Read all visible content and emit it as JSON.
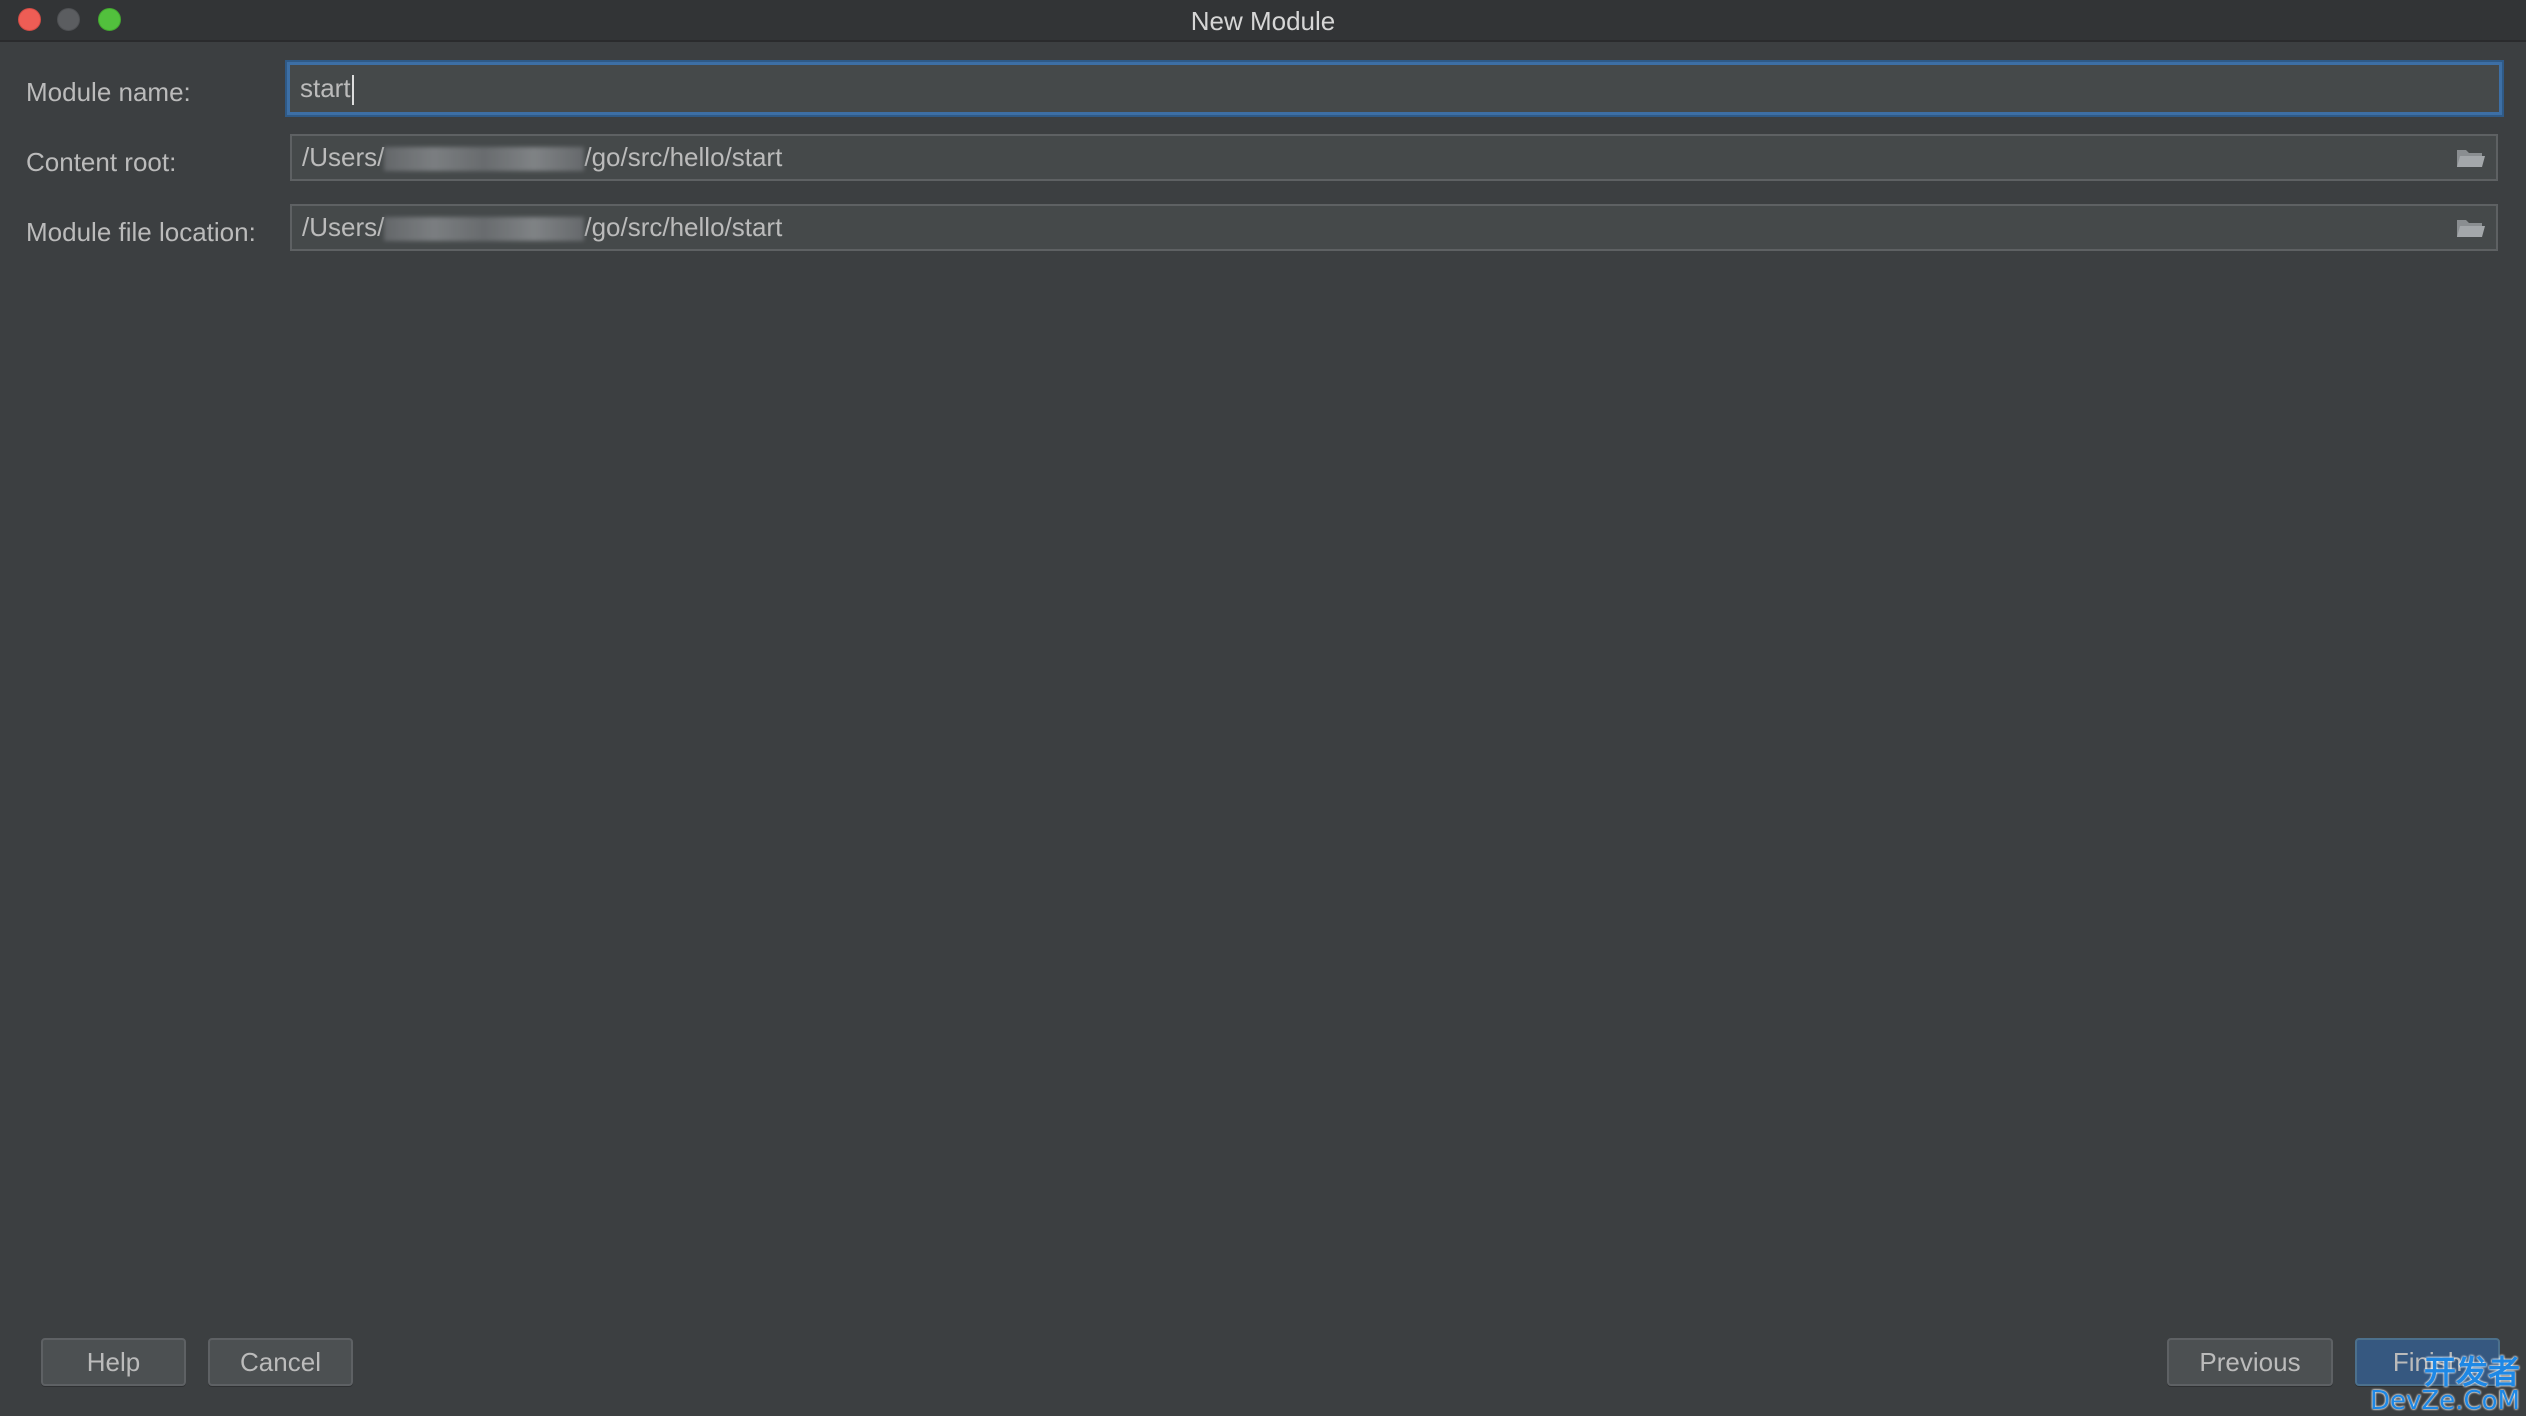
{
  "window": {
    "title": "New Module"
  },
  "form": {
    "module_name": {
      "label": "Module name:",
      "value": "start"
    },
    "content_root": {
      "label": "Content root:",
      "value_prefix": "/Users/",
      "value_suffix": "/go/src/hello/start"
    },
    "module_file_location": {
      "label": "Module file location:",
      "value_prefix": "/Users/",
      "value_suffix": "/go/src/hello/start"
    }
  },
  "buttons": {
    "help": "Help",
    "cancel": "Cancel",
    "previous": "Previous",
    "finish": "Finish"
  },
  "watermark": {
    "line1": "开发者",
    "line2": "DevZe.CoM"
  },
  "colors": {
    "background": "#3c3f41",
    "field_background": "#45494a",
    "focus_border": "#3d6fa5",
    "default_button": "#365880",
    "close": "#ee5d55",
    "minimize": "#5b5d60",
    "maximize": "#52c03d"
  },
  "icons": {
    "browse": "folder-icon"
  }
}
